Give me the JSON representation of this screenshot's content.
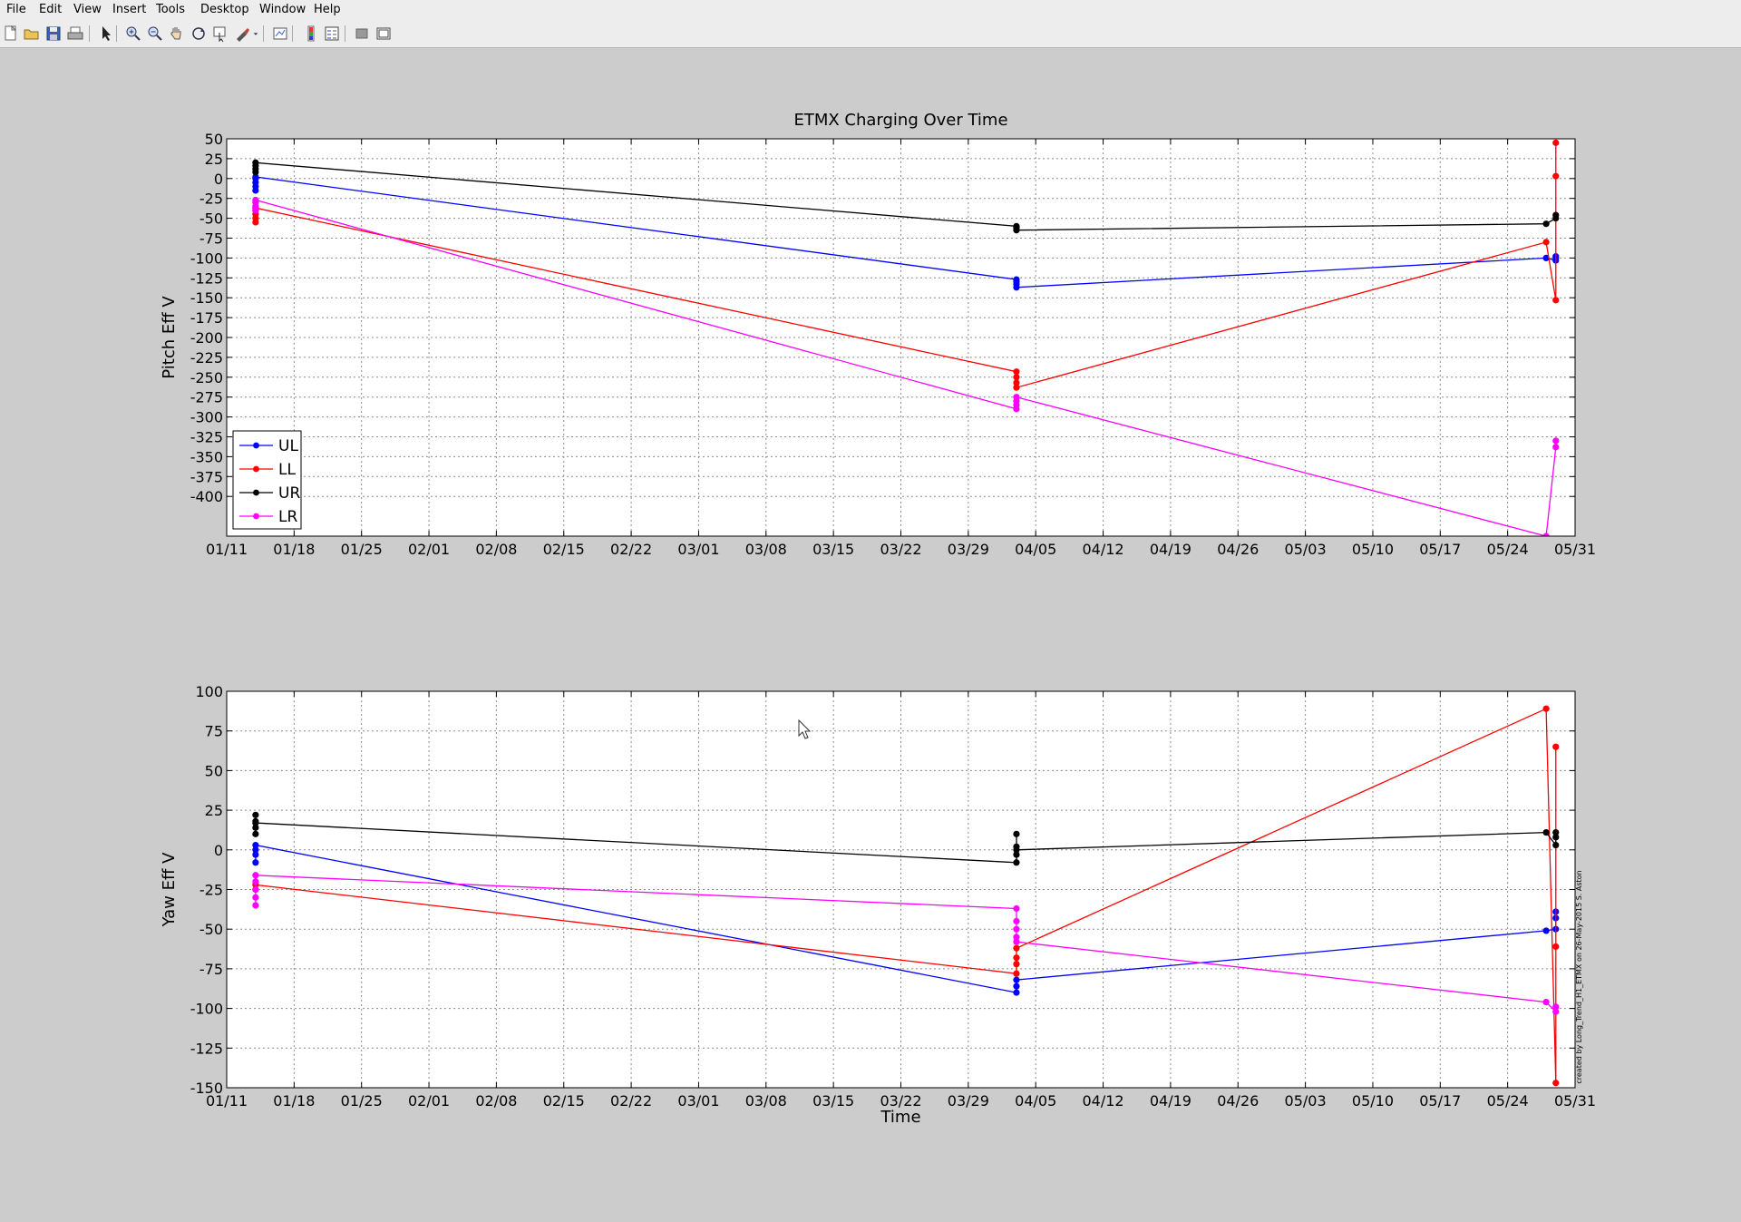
{
  "menu": [
    "File",
    "Edit",
    "View",
    "Insert",
    "Tools",
    "Desktop",
    "Window",
    "Help"
  ],
  "toolbar": {
    "buttons": [
      "new-figure-icon",
      "open-file-icon",
      "save-icon",
      "print-icon",
      "select-arrow-icon",
      "zoom-in-icon",
      "zoom-out-icon",
      "pan-hand-icon",
      "rotate-3d-icon",
      "data-cursor-icon",
      "brush-icon",
      "brush-dropdown-icon",
      "link-plot-icon",
      "colorbar-icon",
      "legend-icon",
      "hide-plot-tools-icon",
      "show-plot-tools-icon"
    ]
  },
  "colors": {
    "UL": "#0000ff",
    "LL": "#ff0000",
    "UR": "#000000",
    "LR": "#ff00ff"
  },
  "side_note": "created by Long_Trend_H1_ETMX on 26-May-2015 S. Aston",
  "chart_data": [
    {
      "type": "line",
      "title": "ETMX Charging Over Time",
      "xlabel": "",
      "ylabel": "Pitch Eff V",
      "x_type": "date",
      "xlim": [
        "01/11",
        "05/31"
      ],
      "xticks": [
        "01/11",
        "01/18",
        "01/25",
        "02/01",
        "02/08",
        "02/15",
        "02/22",
        "03/01",
        "03/08",
        "03/15",
        "03/22",
        "03/29",
        "04/05",
        "04/12",
        "04/19",
        "04/26",
        "05/03",
        "05/10",
        "05/17",
        "05/24",
        "05/31"
      ],
      "ylim": [
        -450,
        50
      ],
      "yticks": [
        "50",
        "25",
        "0",
        "-25",
        "-50",
        "-75",
        "-100",
        "-125",
        "-150",
        "-175",
        "-200",
        "-225",
        "-250",
        "-275",
        "-300",
        "-325",
        "-350",
        "-375",
        "-400"
      ],
      "grid": true,
      "legend": "bottom-left",
      "series": [
        {
          "name": "UL",
          "color": "#0000ff",
          "points": [
            [
              "01/14",
              -15
            ],
            [
              "01/14",
              -10
            ],
            [
              "01/14",
              -5
            ],
            [
              "01/14",
              0
            ],
            [
              "01/14",
              2
            ],
            [
              "04/03",
              -127
            ],
            [
              "04/03",
              -130
            ],
            [
              "04/03",
              -133
            ],
            [
              "04/03",
              -137
            ],
            [
              "05/28",
              -100
            ],
            [
              "05/29",
              -103
            ],
            [
              "05/29",
              -100
            ],
            [
              "05/29",
              -98
            ]
          ]
        },
        {
          "name": "LL",
          "color": "#ff0000",
          "points": [
            [
              "01/14",
              -55
            ],
            [
              "01/14",
              -50
            ],
            [
              "01/14",
              -45
            ],
            [
              "01/14",
              -40
            ],
            [
              "01/14",
              -37
            ],
            [
              "04/03",
              -243
            ],
            [
              "04/03",
              -250
            ],
            [
              "04/03",
              -257
            ],
            [
              "04/03",
              -263
            ],
            [
              "05/28",
              -80
            ],
            [
              "05/29",
              -153
            ],
            [
              "05/29",
              3
            ],
            [
              "05/29",
              45
            ]
          ]
        },
        {
          "name": "UR",
          "color": "#000000",
          "points": [
            [
              "01/14",
              8
            ],
            [
              "01/14",
              12
            ],
            [
              "01/14",
              16
            ],
            [
              "01/14",
              20
            ],
            [
              "04/03",
              -60
            ],
            [
              "04/03",
              -62
            ],
            [
              "04/03",
              -65
            ],
            [
              "05/28",
              -57
            ],
            [
              "05/29",
              -50
            ],
            [
              "05/29",
              -46
            ]
          ]
        },
        {
          "name": "LR",
          "color": "#ff00ff",
          "points": [
            [
              "01/14",
              -40
            ],
            [
              "01/14",
              -35
            ],
            [
              "01/14",
              -30
            ],
            [
              "01/14",
              -27
            ],
            [
              "04/03",
              -290
            ],
            [
              "04/03",
              -285
            ],
            [
              "04/03",
              -280
            ],
            [
              "04/03",
              -275
            ],
            [
              "05/28",
              -450
            ],
            [
              "05/29",
              -338
            ],
            [
              "05/29",
              -330
            ]
          ]
        }
      ]
    },
    {
      "type": "line",
      "title": "",
      "xlabel": "Time",
      "ylabel": "Yaw Eff V",
      "x_type": "date",
      "xlim": [
        "01/11",
        "05/31"
      ],
      "xticks": [
        "01/11",
        "01/18",
        "01/25",
        "02/01",
        "02/08",
        "02/15",
        "02/22",
        "03/01",
        "03/08",
        "03/15",
        "03/22",
        "03/29",
        "04/05",
        "04/12",
        "04/19",
        "04/26",
        "05/03",
        "05/10",
        "05/17",
        "05/24",
        "05/31"
      ],
      "ylim": [
        -150,
        100
      ],
      "yticks": [
        "100",
        "75",
        "50",
        "25",
        "0",
        "-25",
        "-50",
        "-75",
        "-100",
        "-125",
        "-150"
      ],
      "grid": true,
      "series": [
        {
          "name": "UL",
          "color": "#0000ff",
          "points": [
            [
              "01/14",
              -8
            ],
            [
              "01/14",
              -3
            ],
            [
              "01/14",
              0
            ],
            [
              "01/14",
              3
            ],
            [
              "04/03",
              -90
            ],
            [
              "04/03",
              -86
            ],
            [
              "04/03",
              -82
            ],
            [
              "05/28",
              -51
            ],
            [
              "05/29",
              -50
            ],
            [
              "05/29",
              -43
            ],
            [
              "05/29",
              -39
            ]
          ]
        },
        {
          "name": "LL",
          "color": "#ff0000",
          "points": [
            [
              "01/14",
              -25
            ],
            [
              "01/14",
              -22
            ],
            [
              "04/03",
              -78
            ],
            [
              "04/03",
              -72
            ],
            [
              "04/03",
              -68
            ],
            [
              "04/03",
              -62
            ],
            [
              "05/28",
              89
            ],
            [
              "05/29",
              -147
            ],
            [
              "05/29",
              -61
            ],
            [
              "05/29",
              65
            ]
          ]
        },
        {
          "name": "UR",
          "color": "#000000",
          "points": [
            [
              "01/14",
              22
            ],
            [
              "01/14",
              18
            ],
            [
              "01/14",
              14
            ],
            [
              "01/14",
              10
            ],
            [
              "01/14",
              17
            ],
            [
              "04/03",
              -8
            ],
            [
              "04/03",
              -3
            ],
            [
              "04/03",
              2
            ],
            [
              "04/03",
              10
            ],
            [
              "04/03",
              0
            ],
            [
              "05/28",
              11
            ],
            [
              "05/29",
              3
            ],
            [
              "05/29",
              8
            ],
            [
              "05/29",
              11
            ]
          ]
        },
        {
          "name": "LR",
          "color": "#ff00ff",
          "points": [
            [
              "01/14",
              -35
            ],
            [
              "01/14",
              -30
            ],
            [
              "01/14",
              -25
            ],
            [
              "01/14",
              -20
            ],
            [
              "01/14",
              -16
            ],
            [
              "04/03",
              -37
            ],
            [
              "04/03",
              -45
            ],
            [
              "04/03",
              -50
            ],
            [
              "04/03",
              -55
            ],
            [
              "04/03",
              -58
            ],
            [
              "05/28",
              -96
            ],
            [
              "05/29",
              -102
            ],
            [
              "05/29",
              -99
            ]
          ]
        }
      ]
    }
  ]
}
